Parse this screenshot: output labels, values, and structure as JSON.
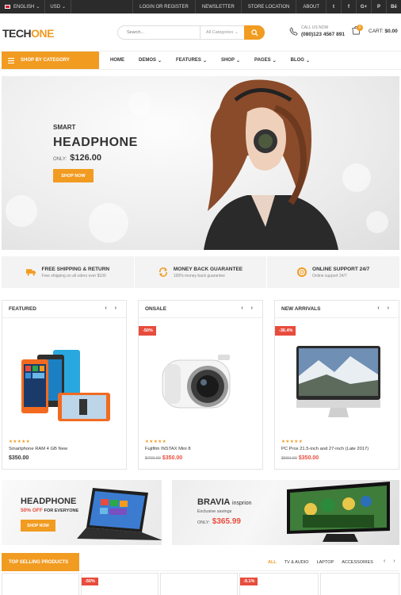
{
  "topbar": {
    "language": "ENGLISH",
    "currency": "USD",
    "links": [
      "LOGIN OR REGISTER",
      "NEWSLETTER",
      "STORE LOCATION",
      "ABOUT"
    ],
    "social": [
      "twitter-icon",
      "facebook-icon",
      "google-plus-icon",
      "pinterest-icon",
      "behance-icon"
    ],
    "social_glyphs": [
      "t",
      "f",
      "G+",
      "P",
      "Bē"
    ]
  },
  "header": {
    "logo_dark": "TECH",
    "logo_accent": "ONE",
    "search_placeholder": "Search...",
    "search_category": "All Categories",
    "call_label": "CALL US NOW",
    "phone": "(080)123 4567 891",
    "cart_count": "0",
    "cart_label": "CART:",
    "cart_total": "$0.00"
  },
  "nav": {
    "category_button": "SHOP BY CATEGORY",
    "items": [
      "HOME",
      "DEMOS",
      "FEATURES",
      "SHOP",
      "PAGES",
      "BLOG"
    ]
  },
  "hero": {
    "subtitle": "SMART",
    "title": "HEADPHONE",
    "price_label": "ONLY:",
    "price": "$126.00",
    "button": "SHOP NOW"
  },
  "features": [
    {
      "title": "FREE SHIPPING & RETURN",
      "sub": "Free shipping on all oders over $100",
      "icon": "truck-icon"
    },
    {
      "title": "MONEY BACK GUARANTEE",
      "sub": "100% money back guarantee",
      "icon": "refresh-icon"
    },
    {
      "title": "ONLINE SUPPORT 24/7",
      "sub": "Online support 24/7",
      "icon": "lifebuoy-icon"
    }
  ],
  "columns": [
    {
      "title": "FEATURED",
      "tag": "",
      "stars": "★★★★★",
      "name": "Smartphone RAM 4 GB New",
      "old_price": "",
      "price": "$350.00"
    },
    {
      "title": "ONSALE",
      "tag": "-50%",
      "stars": "★★★★★",
      "name": "Fujifilm INSTAX Mini 8",
      "old_price": "$700.00",
      "price": "$350.00"
    },
    {
      "title": "NEW ARRIVALS",
      "tag": "-36.4%",
      "stars": "★★★★★",
      "name": "PC Prox 21.5-inch and 27-inch (Late 2017)",
      "old_price": "$550.00",
      "price": "$350.00"
    }
  ],
  "banner1": {
    "title": "HEADPHONE",
    "discount": "50% OFF",
    "discount_suffix": "FOR EVERYONE",
    "button": "SHOP NOW"
  },
  "banner2": {
    "brand": "BRAVIA",
    "brand_suffix": "insprion",
    "sub": "Exclusive savings",
    "price_label": "ONLY:",
    "price": "$365.99"
  },
  "top_selling": {
    "title": "TOP SELLING PRODUCTS",
    "tabs": [
      "ALL",
      "TV & AUDIO",
      "LAPTOP",
      "ACCESSORIES"
    ],
    "tags": [
      "-50%",
      "-9.1%"
    ]
  },
  "colors": {
    "accent": "#f19b21",
    "sale": "#e84c3d",
    "topbar": "#2b2b2b"
  }
}
